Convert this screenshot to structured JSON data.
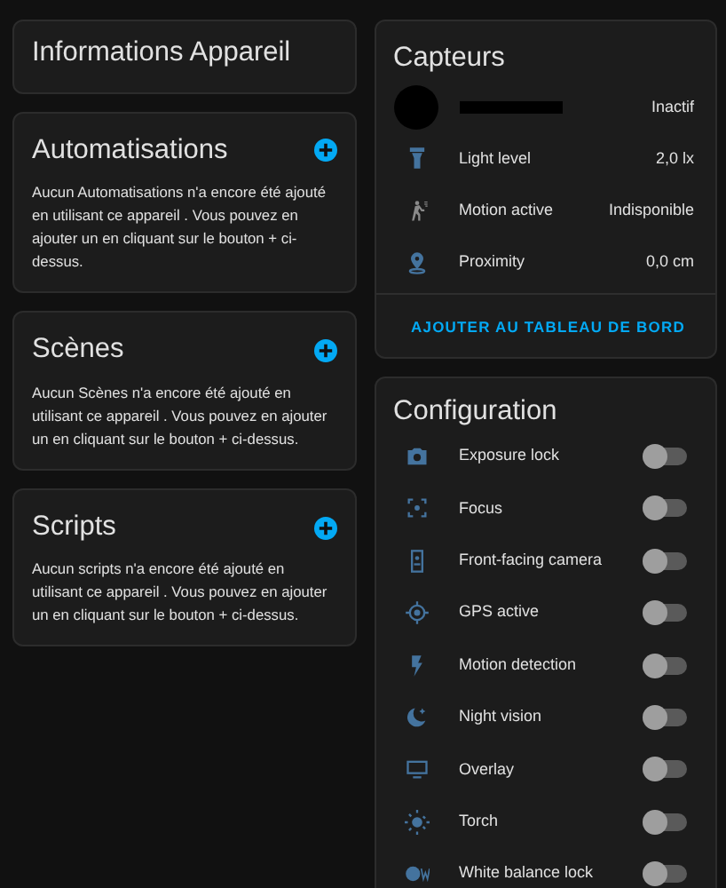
{
  "left_cards": [
    {
      "title": "Informations Appareil"
    },
    {
      "title": "Automatisations",
      "text": "Aucun Automatisations n'a encore été ajouté en utilisant ce appareil . Vous pouvez en ajouter un en cliquant sur le bouton + ci-dessus."
    },
    {
      "title": "Scènes",
      "text": "Aucun Scènes n'a encore été ajouté en utilisant ce appareil . Vous pouvez en ajouter un en cliquant sur le bouton + ci-dessus."
    },
    {
      "title": "Scripts",
      "text": "Aucun scripts n'a encore été ajouté en utilisant ce appareil . Vous pouvez en ajouter un en cliquant sur le bouton + ci-dessus."
    }
  ],
  "sensors": {
    "title": "Capteurs",
    "rows": [
      {
        "kind": "redacted",
        "state": "Inactif"
      },
      {
        "kind": "sensor",
        "name": "Light level",
        "state": "2,0 lx",
        "available": true
      },
      {
        "kind": "sensor",
        "name": "Motion active",
        "state": "Indisponible",
        "available": false
      },
      {
        "kind": "sensor",
        "name": "Proximity",
        "state": "0,0 cm",
        "available": true
      }
    ],
    "action": "AJOUTER AU TABLEAU DE BORD"
  },
  "configuration": {
    "title": "Configuration",
    "rows": [
      {
        "name": "Exposure lock",
        "on": false
      },
      {
        "name": "Focus",
        "on": false
      },
      {
        "name": "Front-facing camera",
        "on": false
      },
      {
        "name": "GPS active",
        "on": false
      },
      {
        "name": "Motion detection",
        "on": false
      },
      {
        "name": "Night vision",
        "on": false
      },
      {
        "name": "Overlay",
        "on": false
      },
      {
        "name": "Torch",
        "on": false
      },
      {
        "name": "White balance lock",
        "on": false
      }
    ]
  }
}
